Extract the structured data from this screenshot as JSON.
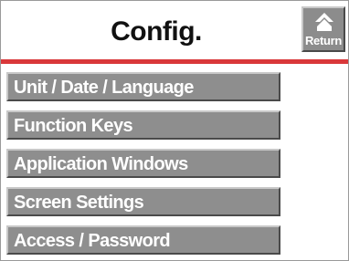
{
  "header": {
    "title": "Config.",
    "return_label": "Return",
    "return_icon": "home-arrow-up-icon"
  },
  "menu": {
    "items": [
      {
        "label": "Unit / Date / Language"
      },
      {
        "label": "Function Keys"
      },
      {
        "label": "Application Windows"
      },
      {
        "label": "Screen Settings"
      },
      {
        "label": "Access / Password"
      }
    ]
  },
  "colors": {
    "accent_rule": "#d9383a",
    "button_face": "#8e8e8e",
    "button_text": "#ffffff",
    "title_text": "#111111"
  }
}
